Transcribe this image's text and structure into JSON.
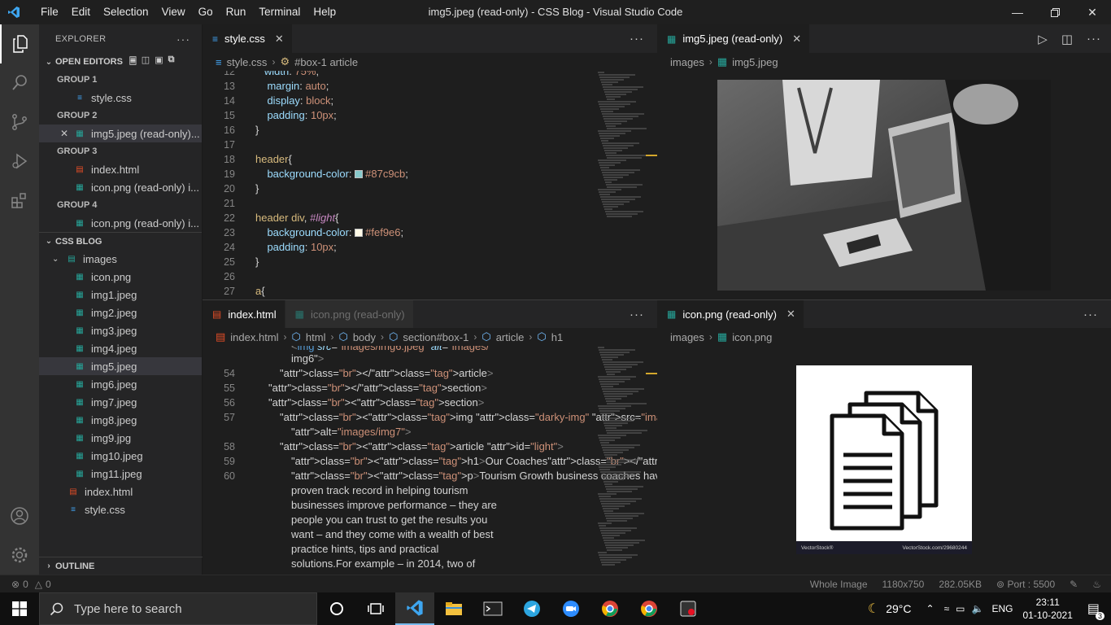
{
  "window": {
    "title": "img5.jpeg (read-only) - CSS Blog - Visual Studio Code",
    "menu": [
      "File",
      "Edit",
      "Selection",
      "View",
      "Go",
      "Run",
      "Terminal",
      "Help"
    ]
  },
  "explorer": {
    "header": "EXPLORER",
    "open_editors_label": "OPEN EDITORS",
    "groups": [
      {
        "label": "GROUP 1",
        "files": [
          {
            "name": "style.css",
            "type": "css"
          }
        ]
      },
      {
        "label": "GROUP 2",
        "files": [
          {
            "name": "img5.jpeg (read-only)...",
            "type": "img"
          }
        ]
      },
      {
        "label": "GROUP 3",
        "files": [
          {
            "name": "index.html",
            "type": "html"
          },
          {
            "name": "icon.png (read-only)  i...",
            "type": "img"
          }
        ]
      },
      {
        "label": "GROUP 4",
        "files": [
          {
            "name": "icon.png (read-only)  i...",
            "type": "img"
          }
        ]
      }
    ],
    "project_label": "CSS BLOG",
    "folder": "images",
    "images": [
      "icon.png",
      "img1.jpeg",
      "img2.jpeg",
      "img3.jpeg",
      "img4.jpeg",
      "img5.jpeg",
      "img6.jpeg",
      "img7.jpeg",
      "img8.jpeg",
      "img9.jpg",
      "img10.jpeg",
      "img11.jpeg"
    ],
    "root_files": [
      "index.html",
      "style.css"
    ],
    "outline_label": "OUTLINE"
  },
  "editor_top_left": {
    "tab": "style.css",
    "breadcrumb": [
      "style.css",
      "#box-1 article"
    ],
    "lines": [
      {
        "n": "13",
        "text": "  margin: auto;"
      },
      {
        "n": "14",
        "text": "  display: block;"
      },
      {
        "n": "15",
        "text": "  padding: 10px;"
      },
      {
        "n": "16",
        "text": "}"
      },
      {
        "n": "17",
        "text": ""
      },
      {
        "n": "18",
        "text": "header{"
      },
      {
        "n": "19",
        "text": "  background-color: #87c9cb;"
      },
      {
        "n": "20",
        "text": "}"
      },
      {
        "n": "21",
        "text": ""
      },
      {
        "n": "22",
        "text": "header div, #light{"
      },
      {
        "n": "23",
        "text": "  background-color: #fef9e6;"
      },
      {
        "n": "24",
        "text": "  padding: 10px;"
      },
      {
        "n": "25",
        "text": "}"
      },
      {
        "n": "26",
        "text": ""
      },
      {
        "n": "27",
        "text": "a{"
      }
    ],
    "colors": {
      "header_bg": "#87c9cb",
      "light_bg": "#fef9e6"
    }
  },
  "editor_top_right": {
    "tab": "img5.jpeg (read-only)",
    "breadcrumb": [
      "images",
      "img5.jpeg"
    ]
  },
  "editor_bottom_left": {
    "tabs": [
      "index.html",
      "icon.png (read-only)"
    ],
    "breadcrumb": [
      "index.html",
      "html",
      "body",
      "section#box-1",
      "article",
      "h1"
    ],
    "lines": [
      {
        "n": "",
        "text": "img6\">"
      },
      {
        "n": "54",
        "text": "</article>"
      },
      {
        "n": "55",
        "text": "</section>"
      },
      {
        "n": "56",
        "text": "<section>"
      },
      {
        "n": "57",
        "text": "<img class=\"darky-img\" src=\"images/img7.jpeg\""
      },
      {
        "n": "",
        "text": "alt=\"images/img7\">"
      },
      {
        "n": "58",
        "text": "<article id=\"light\">"
      },
      {
        "n": "59",
        "text": "<h1>Our Coaches</h1>"
      },
      {
        "n": "60",
        "text": "<p>Tourism Growth business coaches have a"
      },
      {
        "n": "",
        "text": "proven track record in helping tourism"
      },
      {
        "n": "",
        "text": "businesses improve performance – they are"
      },
      {
        "n": "",
        "text": "people you can trust to get the results you"
      },
      {
        "n": "",
        "text": "want – and they come with a wealth of best"
      },
      {
        "n": "",
        "text": "practice hints, tips and practical"
      },
      {
        "n": "",
        "text": "solutions.For example –  in 2014, two of"
      }
    ]
  },
  "editor_bottom_right": {
    "tab": "icon.png (read-only)",
    "breadcrumb": [
      "images",
      "icon.png"
    ],
    "watermark_left": "VectorStock®",
    "watermark_right": "VectorStock.com/29680244"
  },
  "statusbar": {
    "errors": "0",
    "warnings": "0",
    "whole_image": "Whole Image",
    "dimensions": "1180x750",
    "size": "282.05KB",
    "port": "Port : 5500"
  },
  "taskbar": {
    "search_placeholder": "Type here to search",
    "weather": "29°C",
    "language": "ENG",
    "time": "23:11",
    "date": "01-10-2021",
    "notifications": "3"
  }
}
